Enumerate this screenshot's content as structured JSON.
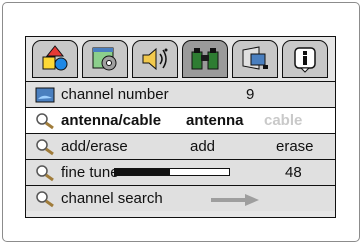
{
  "tabs": [
    {
      "name": "blocks-icon",
      "active": false
    },
    {
      "name": "settings-icon",
      "active": false
    },
    {
      "name": "speaker-icon",
      "active": false
    },
    {
      "name": "binoculars-icon",
      "active": true
    },
    {
      "name": "display-icon",
      "active": false
    },
    {
      "name": "info-icon",
      "active": false
    }
  ],
  "menu": {
    "channel_number": {
      "label": "channel number",
      "value": "9",
      "icon": "monitor-icon"
    },
    "antenna_cable": {
      "label": "antenna/cable",
      "selected_option": "antenna",
      "other_option": "cable",
      "icon": "search-icon"
    },
    "add_erase": {
      "label": "add/erase",
      "option_add": "add",
      "option_erase": "erase",
      "icon": "search-icon"
    },
    "fine_tune": {
      "label": "fine tune",
      "value": "48",
      "level_fraction": 0.48,
      "icon": "search-icon"
    },
    "channel_search": {
      "label": "channel search",
      "icon": "search-icon"
    }
  },
  "colors": {
    "selected_row": "#ffffff",
    "row_bg": "#e0e0e0",
    "dim_text": "#c9c9c9"
  }
}
